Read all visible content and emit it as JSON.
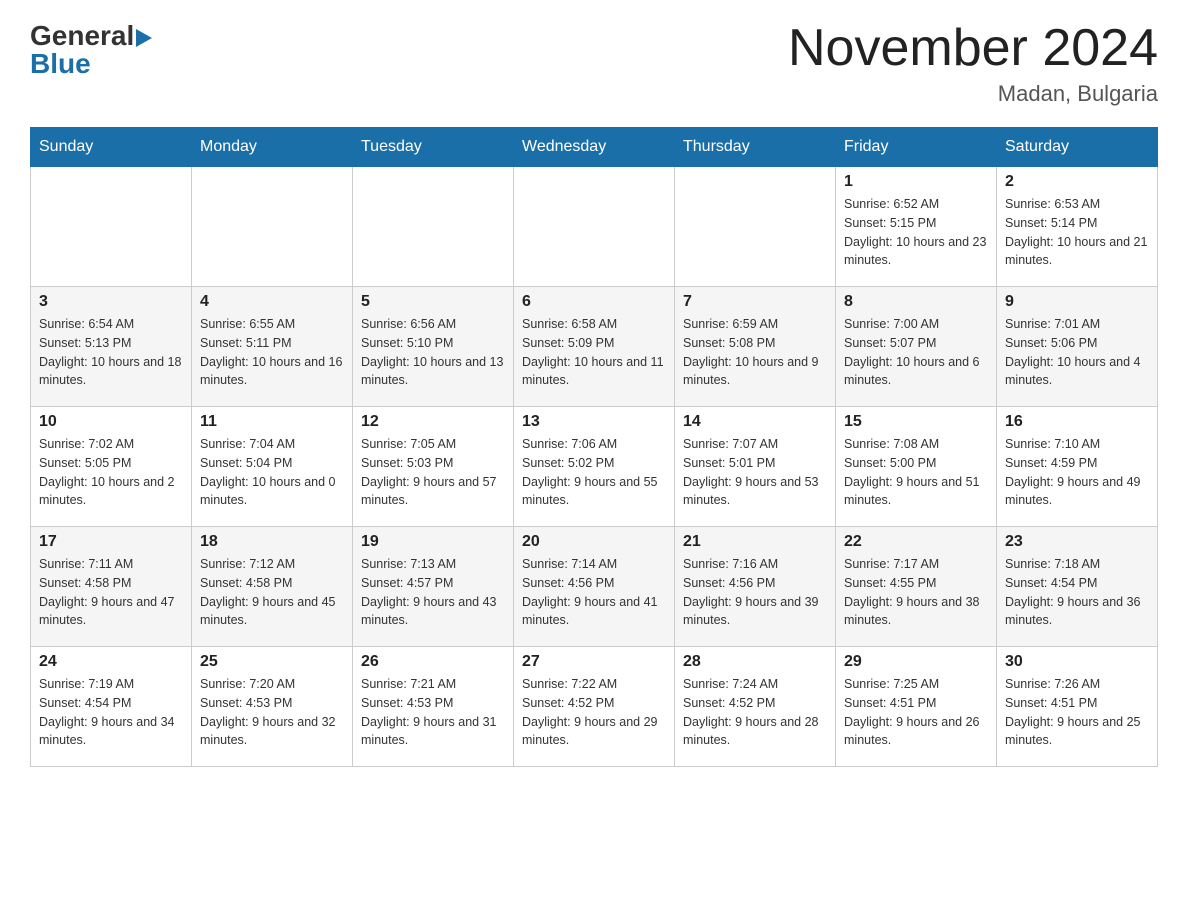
{
  "header": {
    "title": "November 2024",
    "subtitle": "Madan, Bulgaria"
  },
  "logo": {
    "general": "General",
    "blue": "Blue"
  },
  "weekdays": [
    "Sunday",
    "Monday",
    "Tuesday",
    "Wednesday",
    "Thursday",
    "Friday",
    "Saturday"
  ],
  "weeks": [
    [
      {
        "day": "",
        "info": ""
      },
      {
        "day": "",
        "info": ""
      },
      {
        "day": "",
        "info": ""
      },
      {
        "day": "",
        "info": ""
      },
      {
        "day": "",
        "info": ""
      },
      {
        "day": "1",
        "info": "Sunrise: 6:52 AM\nSunset: 5:15 PM\nDaylight: 10 hours and 23 minutes."
      },
      {
        "day": "2",
        "info": "Sunrise: 6:53 AM\nSunset: 5:14 PM\nDaylight: 10 hours and 21 minutes."
      }
    ],
    [
      {
        "day": "3",
        "info": "Sunrise: 6:54 AM\nSunset: 5:13 PM\nDaylight: 10 hours and 18 minutes."
      },
      {
        "day": "4",
        "info": "Sunrise: 6:55 AM\nSunset: 5:11 PM\nDaylight: 10 hours and 16 minutes."
      },
      {
        "day": "5",
        "info": "Sunrise: 6:56 AM\nSunset: 5:10 PM\nDaylight: 10 hours and 13 minutes."
      },
      {
        "day": "6",
        "info": "Sunrise: 6:58 AM\nSunset: 5:09 PM\nDaylight: 10 hours and 11 minutes."
      },
      {
        "day": "7",
        "info": "Sunrise: 6:59 AM\nSunset: 5:08 PM\nDaylight: 10 hours and 9 minutes."
      },
      {
        "day": "8",
        "info": "Sunrise: 7:00 AM\nSunset: 5:07 PM\nDaylight: 10 hours and 6 minutes."
      },
      {
        "day": "9",
        "info": "Sunrise: 7:01 AM\nSunset: 5:06 PM\nDaylight: 10 hours and 4 minutes."
      }
    ],
    [
      {
        "day": "10",
        "info": "Sunrise: 7:02 AM\nSunset: 5:05 PM\nDaylight: 10 hours and 2 minutes."
      },
      {
        "day": "11",
        "info": "Sunrise: 7:04 AM\nSunset: 5:04 PM\nDaylight: 10 hours and 0 minutes."
      },
      {
        "day": "12",
        "info": "Sunrise: 7:05 AM\nSunset: 5:03 PM\nDaylight: 9 hours and 57 minutes."
      },
      {
        "day": "13",
        "info": "Sunrise: 7:06 AM\nSunset: 5:02 PM\nDaylight: 9 hours and 55 minutes."
      },
      {
        "day": "14",
        "info": "Sunrise: 7:07 AM\nSunset: 5:01 PM\nDaylight: 9 hours and 53 minutes."
      },
      {
        "day": "15",
        "info": "Sunrise: 7:08 AM\nSunset: 5:00 PM\nDaylight: 9 hours and 51 minutes."
      },
      {
        "day": "16",
        "info": "Sunrise: 7:10 AM\nSunset: 4:59 PM\nDaylight: 9 hours and 49 minutes."
      }
    ],
    [
      {
        "day": "17",
        "info": "Sunrise: 7:11 AM\nSunset: 4:58 PM\nDaylight: 9 hours and 47 minutes."
      },
      {
        "day": "18",
        "info": "Sunrise: 7:12 AM\nSunset: 4:58 PM\nDaylight: 9 hours and 45 minutes."
      },
      {
        "day": "19",
        "info": "Sunrise: 7:13 AM\nSunset: 4:57 PM\nDaylight: 9 hours and 43 minutes."
      },
      {
        "day": "20",
        "info": "Sunrise: 7:14 AM\nSunset: 4:56 PM\nDaylight: 9 hours and 41 minutes."
      },
      {
        "day": "21",
        "info": "Sunrise: 7:16 AM\nSunset: 4:56 PM\nDaylight: 9 hours and 39 minutes."
      },
      {
        "day": "22",
        "info": "Sunrise: 7:17 AM\nSunset: 4:55 PM\nDaylight: 9 hours and 38 minutes."
      },
      {
        "day": "23",
        "info": "Sunrise: 7:18 AM\nSunset: 4:54 PM\nDaylight: 9 hours and 36 minutes."
      }
    ],
    [
      {
        "day": "24",
        "info": "Sunrise: 7:19 AM\nSunset: 4:54 PM\nDaylight: 9 hours and 34 minutes."
      },
      {
        "day": "25",
        "info": "Sunrise: 7:20 AM\nSunset: 4:53 PM\nDaylight: 9 hours and 32 minutes."
      },
      {
        "day": "26",
        "info": "Sunrise: 7:21 AM\nSunset: 4:53 PM\nDaylight: 9 hours and 31 minutes."
      },
      {
        "day": "27",
        "info": "Sunrise: 7:22 AM\nSunset: 4:52 PM\nDaylight: 9 hours and 29 minutes."
      },
      {
        "day": "28",
        "info": "Sunrise: 7:24 AM\nSunset: 4:52 PM\nDaylight: 9 hours and 28 minutes."
      },
      {
        "day": "29",
        "info": "Sunrise: 7:25 AM\nSunset: 4:51 PM\nDaylight: 9 hours and 26 minutes."
      },
      {
        "day": "30",
        "info": "Sunrise: 7:26 AM\nSunset: 4:51 PM\nDaylight: 9 hours and 25 minutes."
      }
    ]
  ]
}
